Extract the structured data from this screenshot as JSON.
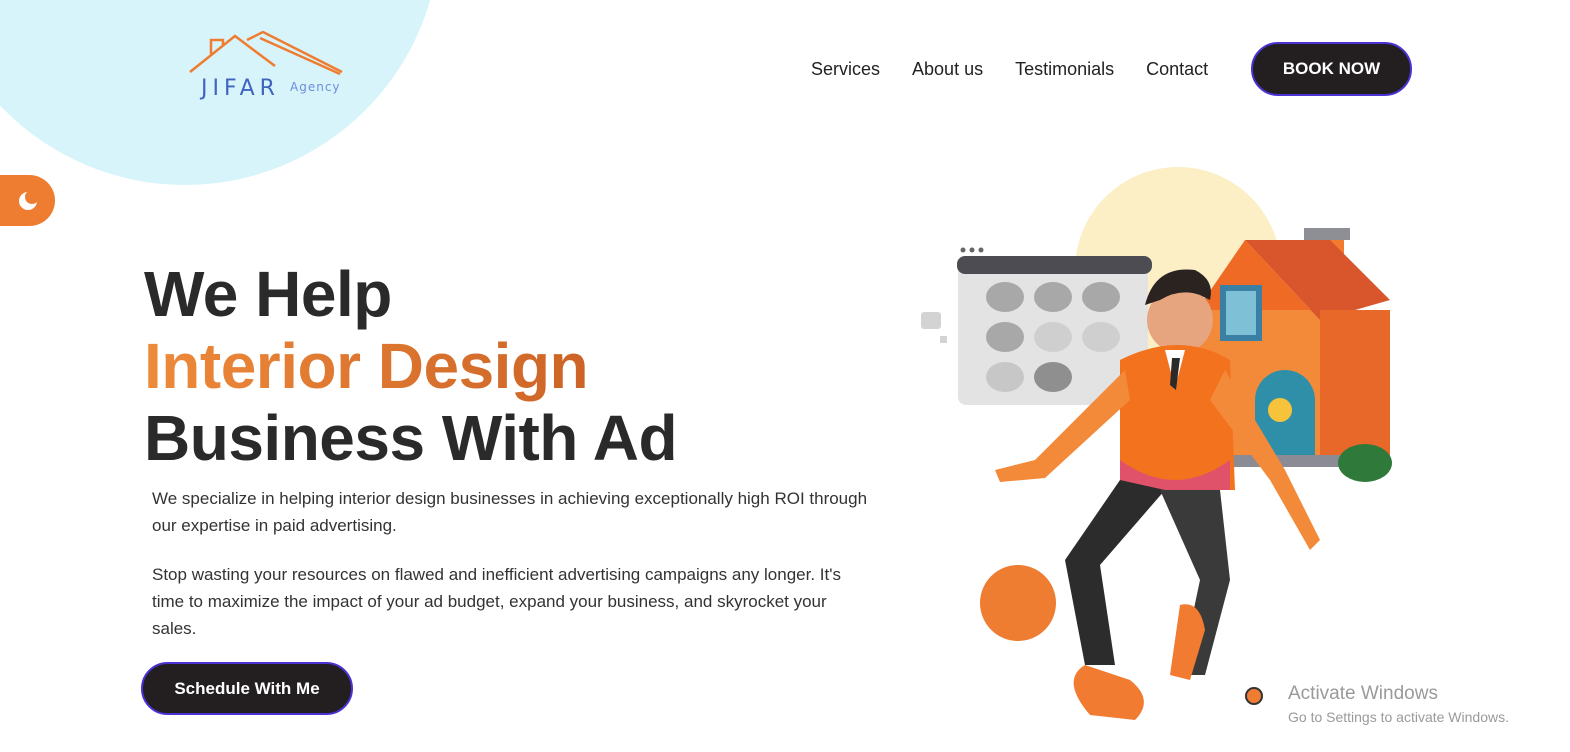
{
  "brand": {
    "logo_word": "JIFAR",
    "logo_sub": "Agency",
    "logo_icon": "house-roof-icon",
    "accent_color": "#ee7d31",
    "dark_color": "#231f20",
    "border_color": "#4a32d4",
    "blob_color": "#d8f4fb"
  },
  "nav": {
    "items": [
      {
        "label": "Services"
      },
      {
        "label": "About us"
      },
      {
        "label": "Testimonials"
      },
      {
        "label": "Contact"
      }
    ],
    "book_label": "BOOK NOW"
  },
  "theme_toggle": {
    "icon": "moon-icon"
  },
  "hero": {
    "line1": "We Help",
    "line2": "Interior Design",
    "line3": "Business With Ad",
    "para1": "We specialize in helping interior design businesses in achieving exceptionally high ROI through our expertise in paid advertising.",
    "para2": "Stop wasting your resources on flawed and inefficient advertising campaigns any longer. It's time to maximize the impact of your ad budget, expand your business, and skyrocket your sales.",
    "cta_label": "Schedule With Me",
    "illustration": "person-with-house-illustration"
  },
  "windows_watermark": {
    "title": "Activate Windows",
    "subtitle": "Go to Settings to activate Windows."
  }
}
